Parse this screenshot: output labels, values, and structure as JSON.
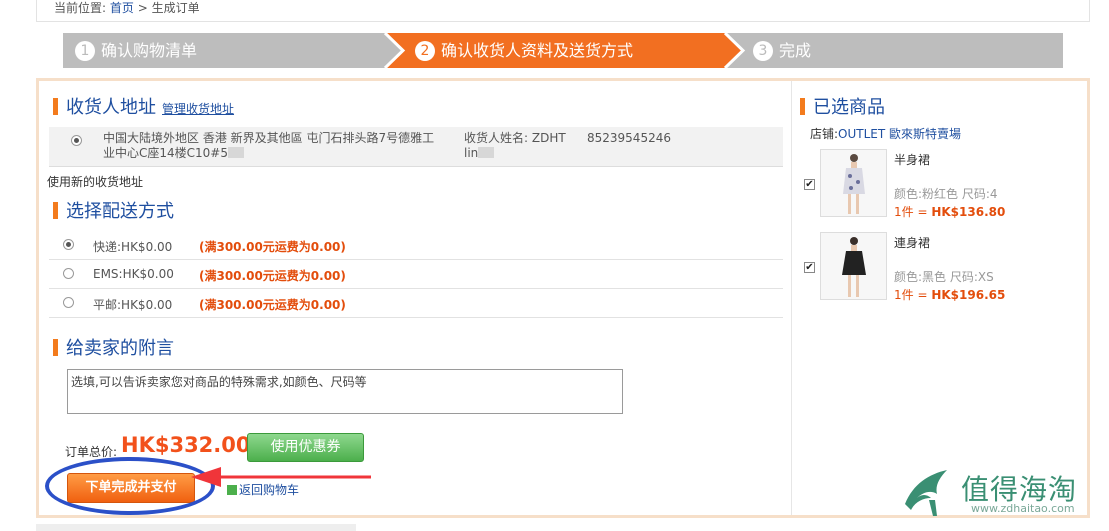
{
  "breadcrumb": {
    "prefix": "当前位置:",
    "home": "首页",
    "sep": ">",
    "current": "生成订单"
  },
  "steps": [
    {
      "num": "1",
      "label": "确认购物清单"
    },
    {
      "num": "2",
      "label": "确认收货人资料及送货方式"
    },
    {
      "num": "3",
      "label": "完成"
    }
  ],
  "address": {
    "title": "收货人地址",
    "manage_link": "管理收货地址",
    "line1": "中国大陆境外地区  香港  新界及其他區    屯门石排头路7号德雅工",
    "line2": "业中心C座14楼C10#5",
    "receiver_label": "收货人姓名: ZDHT",
    "receiver_name": "lin",
    "phone": "85239545246",
    "new_address": "使用新的收货地址"
  },
  "shipping": {
    "title": "选择配送方式",
    "options": [
      {
        "label": "快递:HK$0.00",
        "promo": "(满300.00元运费为0.00)",
        "selected": true
      },
      {
        "label": "EMS:HK$0.00",
        "promo": "(满300.00元运费为0.00)",
        "selected": false
      },
      {
        "label": "平邮:HK$0.00",
        "promo": "(满300.00元运费为0.00)",
        "selected": false
      }
    ]
  },
  "note": {
    "title": "给卖家的附言",
    "placeholder": "选填,可以告诉卖家您对商品的特殊需求,如颜色、尺码等"
  },
  "order": {
    "total_label": "订单总价:",
    "total_value": "HK$332.00",
    "coupon_button": "使用优惠券",
    "submit_button": "下单完成并支付",
    "back_link": "返回购物车"
  },
  "selected": {
    "title": "已选商品",
    "shop_label": "店铺:",
    "shop_name": "OUTLET 歐來斯特賣場",
    "items": [
      {
        "name": "半身裙",
        "attr": "颜色:粉红色 尺码:4",
        "qty": "1件 = ",
        "price": "HK$136.80",
        "checked": true
      },
      {
        "name": "連身裙",
        "attr": "颜色:黑色 尺码:XS",
        "qty": "1件 = ",
        "price": "HK$196.65",
        "checked": true
      }
    ]
  },
  "watermark": {
    "text": "值得海淘",
    "url": "www.zdhaitao.com"
  },
  "colors": {
    "accent": "#f37b1d",
    "link": "#1f4fa0",
    "price": "#f2511b",
    "annotation": "#2b50c8"
  },
  "icons": {
    "radio_selected": "radio-selected-icon",
    "checkbox": "checkbox-checked-icon"
  }
}
